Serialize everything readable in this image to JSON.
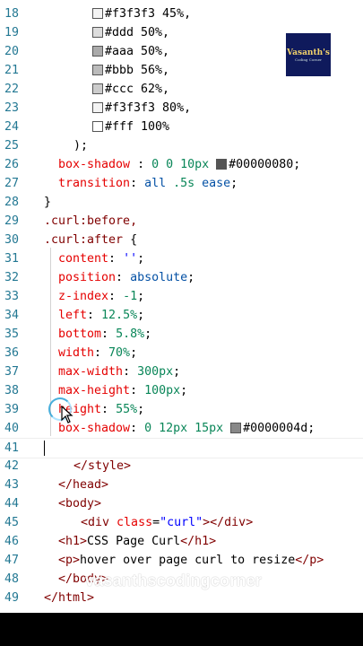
{
  "lines": [
    {
      "n": "18",
      "tokens": [
        {
          "t": "#f3f3f3",
          "c": "txt",
          "sw": "#f3f3f3"
        },
        {
          "t": " 45%,",
          "c": "txt"
        }
      ],
      "indent": 103
    },
    {
      "n": "19",
      "tokens": [
        {
          "t": "#ddd",
          "c": "txt",
          "sw": "#dddddd"
        },
        {
          "t": " 50%,",
          "c": "txt"
        }
      ],
      "indent": 103
    },
    {
      "n": "20",
      "tokens": [
        {
          "t": "#aaa",
          "c": "txt",
          "sw": "#aaaaaa"
        },
        {
          "t": " 50%,",
          "c": "txt"
        }
      ],
      "indent": 103
    },
    {
      "n": "21",
      "tokens": [
        {
          "t": "#bbb",
          "c": "txt",
          "sw": "#bbbbbb"
        },
        {
          "t": " 56%,",
          "c": "txt"
        }
      ],
      "indent": 103
    },
    {
      "n": "22",
      "tokens": [
        {
          "t": "#ccc",
          "c": "txt",
          "sw": "#cccccc"
        },
        {
          "t": " 62%,",
          "c": "txt"
        }
      ],
      "indent": 103
    },
    {
      "n": "23",
      "tokens": [
        {
          "t": "#f3f3f3",
          "c": "txt",
          "sw": "#f3f3f3"
        },
        {
          "t": " 80%,",
          "c": "txt"
        }
      ],
      "indent": 103
    },
    {
      "n": "24",
      "tokens": [
        {
          "t": "#fff",
          "c": "txt",
          "sw": "#ffffff"
        },
        {
          "t": " 100%",
          "c": "txt"
        }
      ],
      "indent": 103
    },
    {
      "n": "25",
      "tokens": [
        {
          "t": ");",
          "c": "txt"
        }
      ],
      "indent": 82
    },
    {
      "n": "26",
      "tokens": [
        {
          "t": "box-shadow",
          "c": "prop"
        },
        {
          "t": " : ",
          "c": "txt"
        },
        {
          "t": "0 0 10px ",
          "c": "num"
        },
        {
          "t": "#00000080",
          "c": "txt",
          "sw": "#555555"
        },
        {
          "t": ";",
          "c": "txt"
        }
      ],
      "indent": 65
    },
    {
      "n": "27",
      "tokens": [
        {
          "t": "transition",
          "c": "prop"
        },
        {
          "t": ": ",
          "c": "txt"
        },
        {
          "t": "all ",
          "c": "kw"
        },
        {
          "t": ".5s ",
          "c": "num"
        },
        {
          "t": "ease",
          "c": "kw"
        },
        {
          "t": ";",
          "c": "txt"
        }
      ],
      "indent": 65
    },
    {
      "n": "28",
      "tokens": [
        {
          "t": "}",
          "c": "txt"
        }
      ],
      "indent": 49
    },
    {
      "n": "29",
      "tokens": [
        {
          "t": ".curl:before,",
          "c": "sel"
        }
      ],
      "indent": 49
    },
    {
      "n": "30",
      "tokens": [
        {
          "t": ".curl:after ",
          "c": "sel"
        },
        {
          "t": "{",
          "c": "txt"
        }
      ],
      "indent": 49
    },
    {
      "n": "31",
      "tokens": [
        {
          "t": "content",
          "c": "prop"
        },
        {
          "t": ": ",
          "c": "txt"
        },
        {
          "t": "''",
          "c": "str"
        },
        {
          "t": ";",
          "c": "txt"
        }
      ],
      "indent": 65
    },
    {
      "n": "32",
      "tokens": [
        {
          "t": "position",
          "c": "prop"
        },
        {
          "t": ": ",
          "c": "txt"
        },
        {
          "t": "absolute",
          "c": "kw"
        },
        {
          "t": ";",
          "c": "txt"
        }
      ],
      "indent": 65
    },
    {
      "n": "33",
      "tokens": [
        {
          "t": "z-index",
          "c": "prop"
        },
        {
          "t": ": ",
          "c": "txt"
        },
        {
          "t": "-1",
          "c": "num"
        },
        {
          "t": ";",
          "c": "txt"
        }
      ],
      "indent": 65
    },
    {
      "n": "34",
      "tokens": [
        {
          "t": "left",
          "c": "prop"
        },
        {
          "t": ": ",
          "c": "txt"
        },
        {
          "t": "12.5%",
          "c": "num"
        },
        {
          "t": ";",
          "c": "txt"
        }
      ],
      "indent": 65
    },
    {
      "n": "35",
      "tokens": [
        {
          "t": "bottom",
          "c": "prop"
        },
        {
          "t": ": ",
          "c": "txt"
        },
        {
          "t": "5.8%",
          "c": "num"
        },
        {
          "t": ";",
          "c": "txt"
        }
      ],
      "indent": 65
    },
    {
      "n": "36",
      "tokens": [
        {
          "t": "width",
          "c": "prop"
        },
        {
          "t": ": ",
          "c": "txt"
        },
        {
          "t": "70%",
          "c": "num"
        },
        {
          "t": ";",
          "c": "txt"
        }
      ],
      "indent": 65
    },
    {
      "n": "37",
      "tokens": [
        {
          "t": "max-width",
          "c": "prop"
        },
        {
          "t": ": ",
          "c": "txt"
        },
        {
          "t": "300px",
          "c": "num"
        },
        {
          "t": ";",
          "c": "txt"
        }
      ],
      "indent": 65
    },
    {
      "n": "38",
      "tokens": [
        {
          "t": "max-height",
          "c": "prop"
        },
        {
          "t": ": ",
          "c": "txt"
        },
        {
          "t": "100px",
          "c": "num"
        },
        {
          "t": ";",
          "c": "txt"
        }
      ],
      "indent": 65
    },
    {
      "n": "39",
      "tokens": [
        {
          "t": "height",
          "c": "prop"
        },
        {
          "t": ": ",
          "c": "txt"
        },
        {
          "t": "55%",
          "c": "num"
        },
        {
          "t": ";",
          "c": "txt"
        }
      ],
      "indent": 65
    },
    {
      "n": "40",
      "tokens": [
        {
          "t": "box-shadow",
          "c": "prop"
        },
        {
          "t": ": ",
          "c": "txt"
        },
        {
          "t": "0 12px 15px ",
          "c": "num"
        },
        {
          "t": "#0000004d",
          "c": "txt",
          "sw": "#888888"
        },
        {
          "t": ";",
          "c": "txt"
        }
      ],
      "indent": 65
    },
    {
      "n": "41",
      "tokens": [],
      "indent": 49,
      "active": true
    },
    {
      "n": "42",
      "tokens": [
        {
          "t": "</",
          "c": "tag"
        },
        {
          "t": "style",
          "c": "tag"
        },
        {
          "t": ">",
          "c": "tag"
        }
      ],
      "indent": 82
    },
    {
      "n": "43",
      "tokens": [
        {
          "t": "</",
          "c": "tag"
        },
        {
          "t": "head",
          "c": "tag"
        },
        {
          "t": ">",
          "c": "tag"
        }
      ],
      "indent": 65
    },
    {
      "n": "44",
      "tokens": [
        {
          "t": "<",
          "c": "tag"
        },
        {
          "t": "body",
          "c": "tag"
        },
        {
          "t": ">",
          "c": "tag"
        }
      ],
      "indent": 65
    },
    {
      "n": "45",
      "tokens": [
        {
          "t": "<",
          "c": "tag"
        },
        {
          "t": "div ",
          "c": "tag"
        },
        {
          "t": "class",
          "c": "attr"
        },
        {
          "t": "=",
          "c": "txt"
        },
        {
          "t": "\"curl\"",
          "c": "str"
        },
        {
          "t": "></",
          "c": "tag"
        },
        {
          "t": "div",
          "c": "tag"
        },
        {
          "t": ">",
          "c": "tag"
        }
      ],
      "indent": 90
    },
    {
      "n": "46",
      "tokens": [
        {
          "t": "<",
          "c": "tag"
        },
        {
          "t": "h1",
          "c": "tag"
        },
        {
          "t": ">",
          "c": "tag"
        },
        {
          "t": "CSS Page Curl",
          "c": "txt"
        },
        {
          "t": "</",
          "c": "tag"
        },
        {
          "t": "h1",
          "c": "tag"
        },
        {
          "t": ">",
          "c": "tag"
        }
      ],
      "indent": 65
    },
    {
      "n": "47",
      "tokens": [
        {
          "t": "<",
          "c": "tag"
        },
        {
          "t": "p",
          "c": "tag"
        },
        {
          "t": ">",
          "c": "tag"
        },
        {
          "t": "hover over page curl to resize",
          "c": "txt"
        },
        {
          "t": "</",
          "c": "tag"
        },
        {
          "t": "p",
          "c": "tag"
        },
        {
          "t": ">",
          "c": "tag"
        }
      ],
      "indent": 65
    },
    {
      "n": "48",
      "tokens": [
        {
          "t": "</",
          "c": "tag"
        },
        {
          "t": "body",
          "c": "tag"
        },
        {
          "t": ">",
          "c": "tag"
        }
      ],
      "indent": 65
    },
    {
      "n": "49",
      "tokens": [
        {
          "t": "</",
          "c": "tag"
        },
        {
          "t": "html",
          "c": "tag"
        },
        {
          "t": ">",
          "c": "tag"
        }
      ],
      "indent": 49
    }
  ],
  "watermark": "vasanthscodingcorner",
  "logo": {
    "title": "Vasanth's",
    "subtitle": "Coding Corner"
  }
}
